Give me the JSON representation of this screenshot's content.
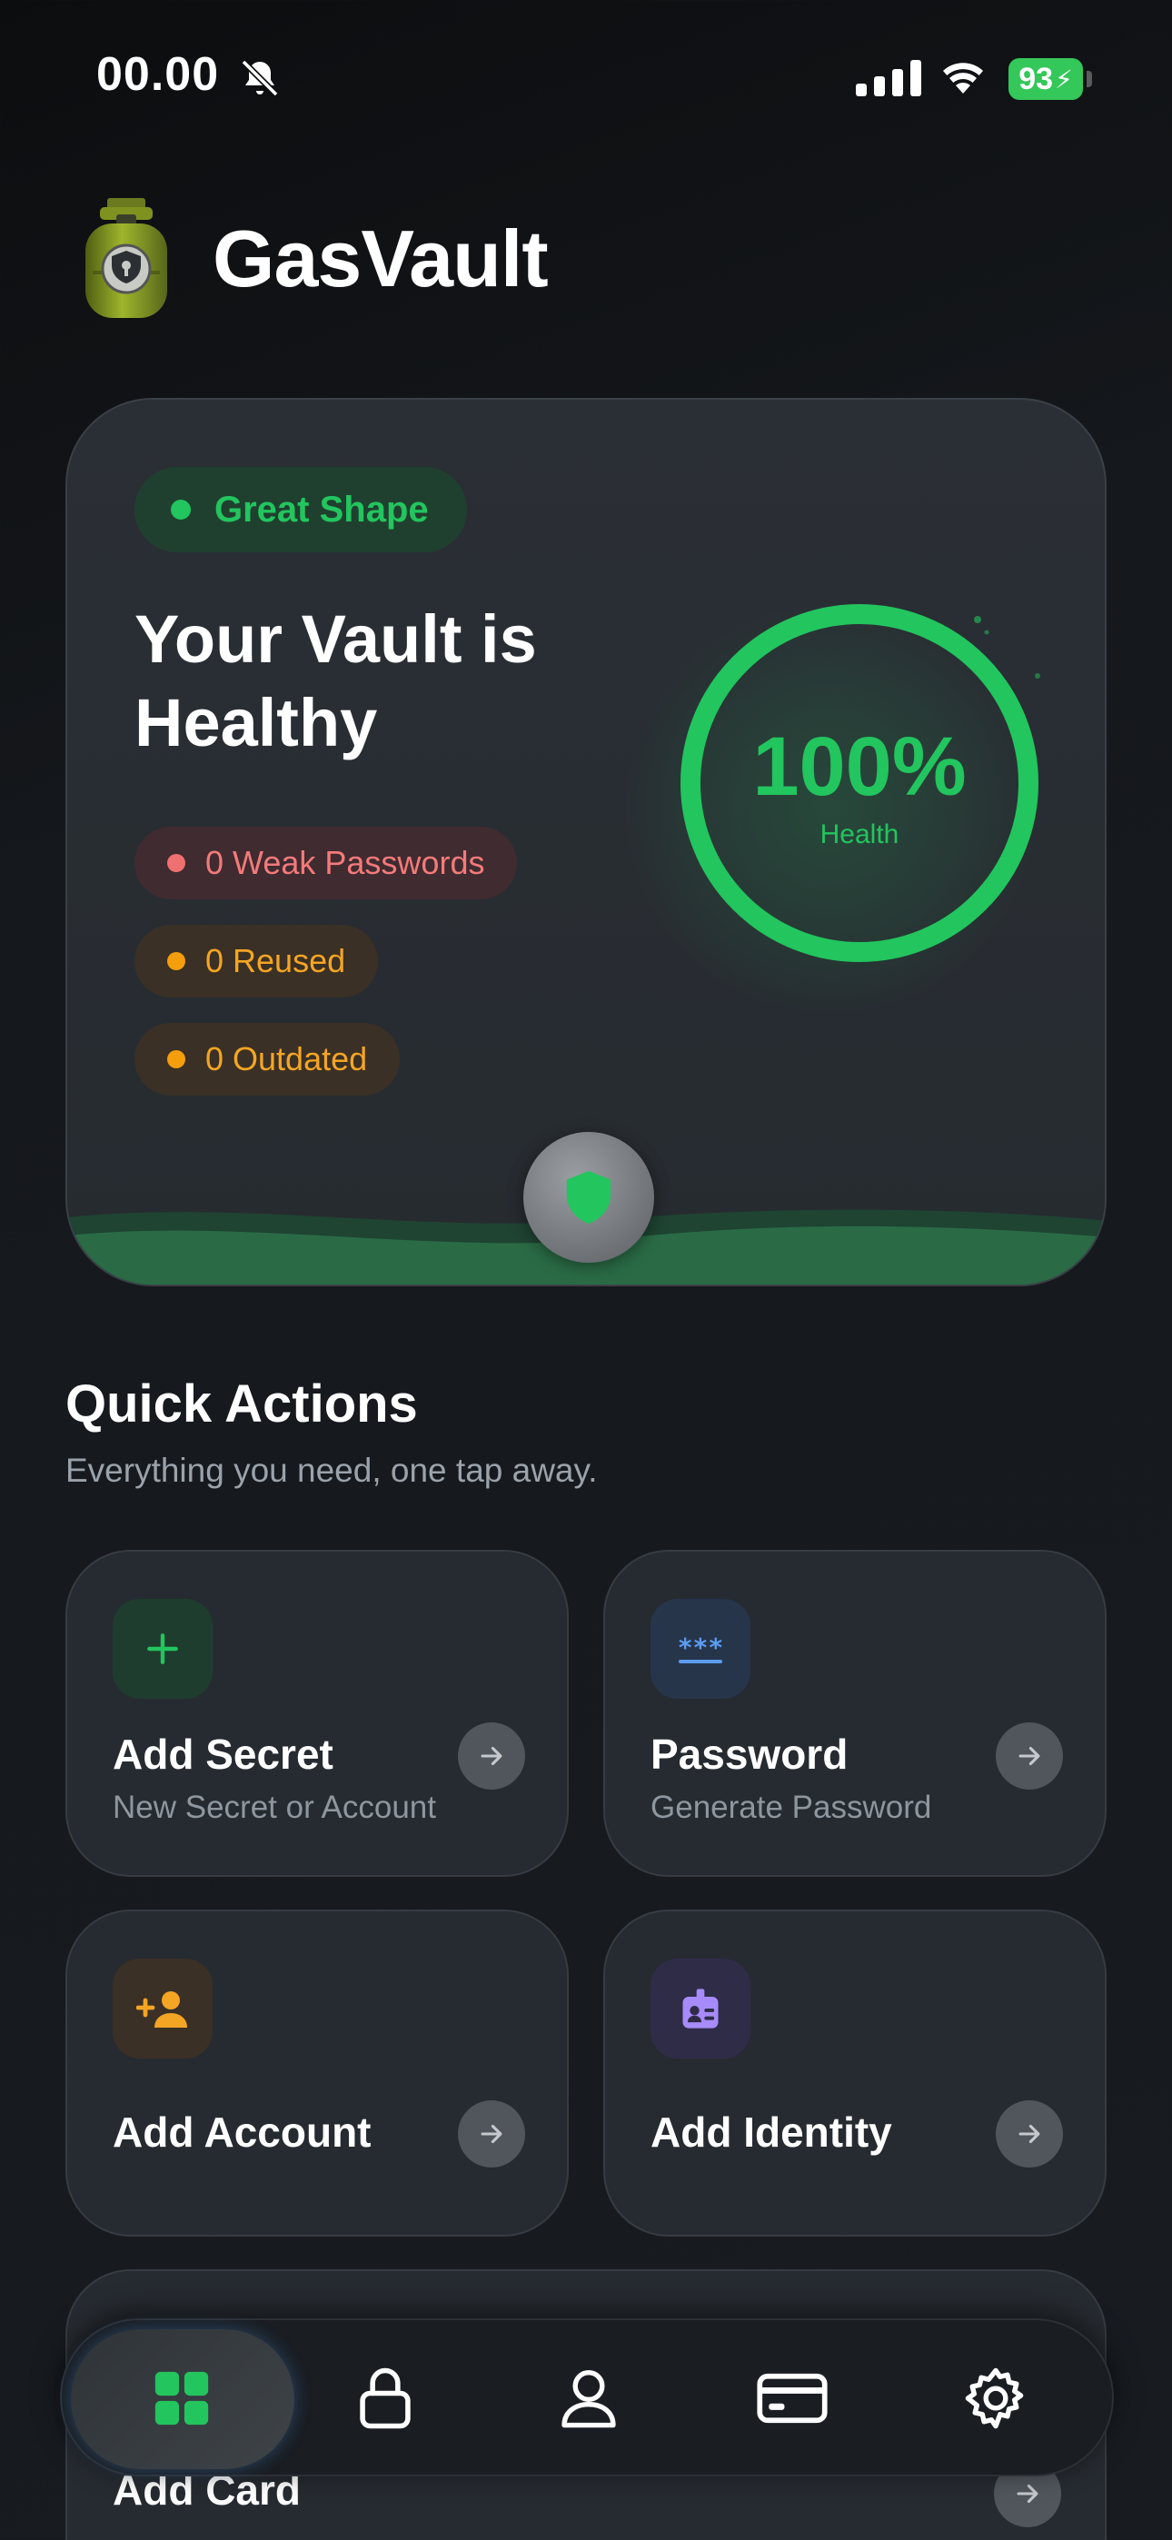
{
  "status_bar": {
    "time": "00.00",
    "battery": "93"
  },
  "header": {
    "title": "GasVault",
    "logo_icon": "gas-cylinder-lock-icon"
  },
  "health_card": {
    "status_label": "Great Shape",
    "title": "Your Vault is Healthy",
    "issues": [
      {
        "label": "0 Weak Passwords",
        "color": "#f47a7a"
      },
      {
        "label": "0 Reused",
        "color": "#f5a524"
      },
      {
        "label": "0 Outdated",
        "color": "#f5a524"
      }
    ],
    "health_percent": 100,
    "health_value": "100%",
    "health_label": "Health",
    "accent": "#22c55e"
  },
  "quick_actions": {
    "title": "Quick Actions",
    "subtitle": "Everything you need, one tap away.",
    "items": [
      {
        "name": "Add Secret",
        "description": "New Secret or Account",
        "icon": "plus-icon",
        "color": "#22c55e"
      },
      {
        "name": "Password",
        "description": "Generate Password",
        "icon": "password-dots-icon",
        "color": "#5b9cf0"
      },
      {
        "name": "Add Account",
        "description": "",
        "icon": "add-person-icon",
        "color": "#f5a524"
      },
      {
        "name": "Add Identity",
        "description": "",
        "icon": "id-badge-icon",
        "color": "#a78bfa"
      },
      {
        "name": "Add Card",
        "description": "",
        "icon": "card-icon",
        "color": "#5b9cf0"
      }
    ]
  },
  "bottom_nav": {
    "items": [
      {
        "id": "dashboard",
        "icon": "grid-icon",
        "active": true
      },
      {
        "id": "vault",
        "icon": "lock-icon",
        "active": false
      },
      {
        "id": "accounts",
        "icon": "person-icon",
        "active": false
      },
      {
        "id": "cards",
        "icon": "credit-card-icon",
        "active": false
      },
      {
        "id": "settings",
        "icon": "gear-icon",
        "active": false
      }
    ]
  }
}
